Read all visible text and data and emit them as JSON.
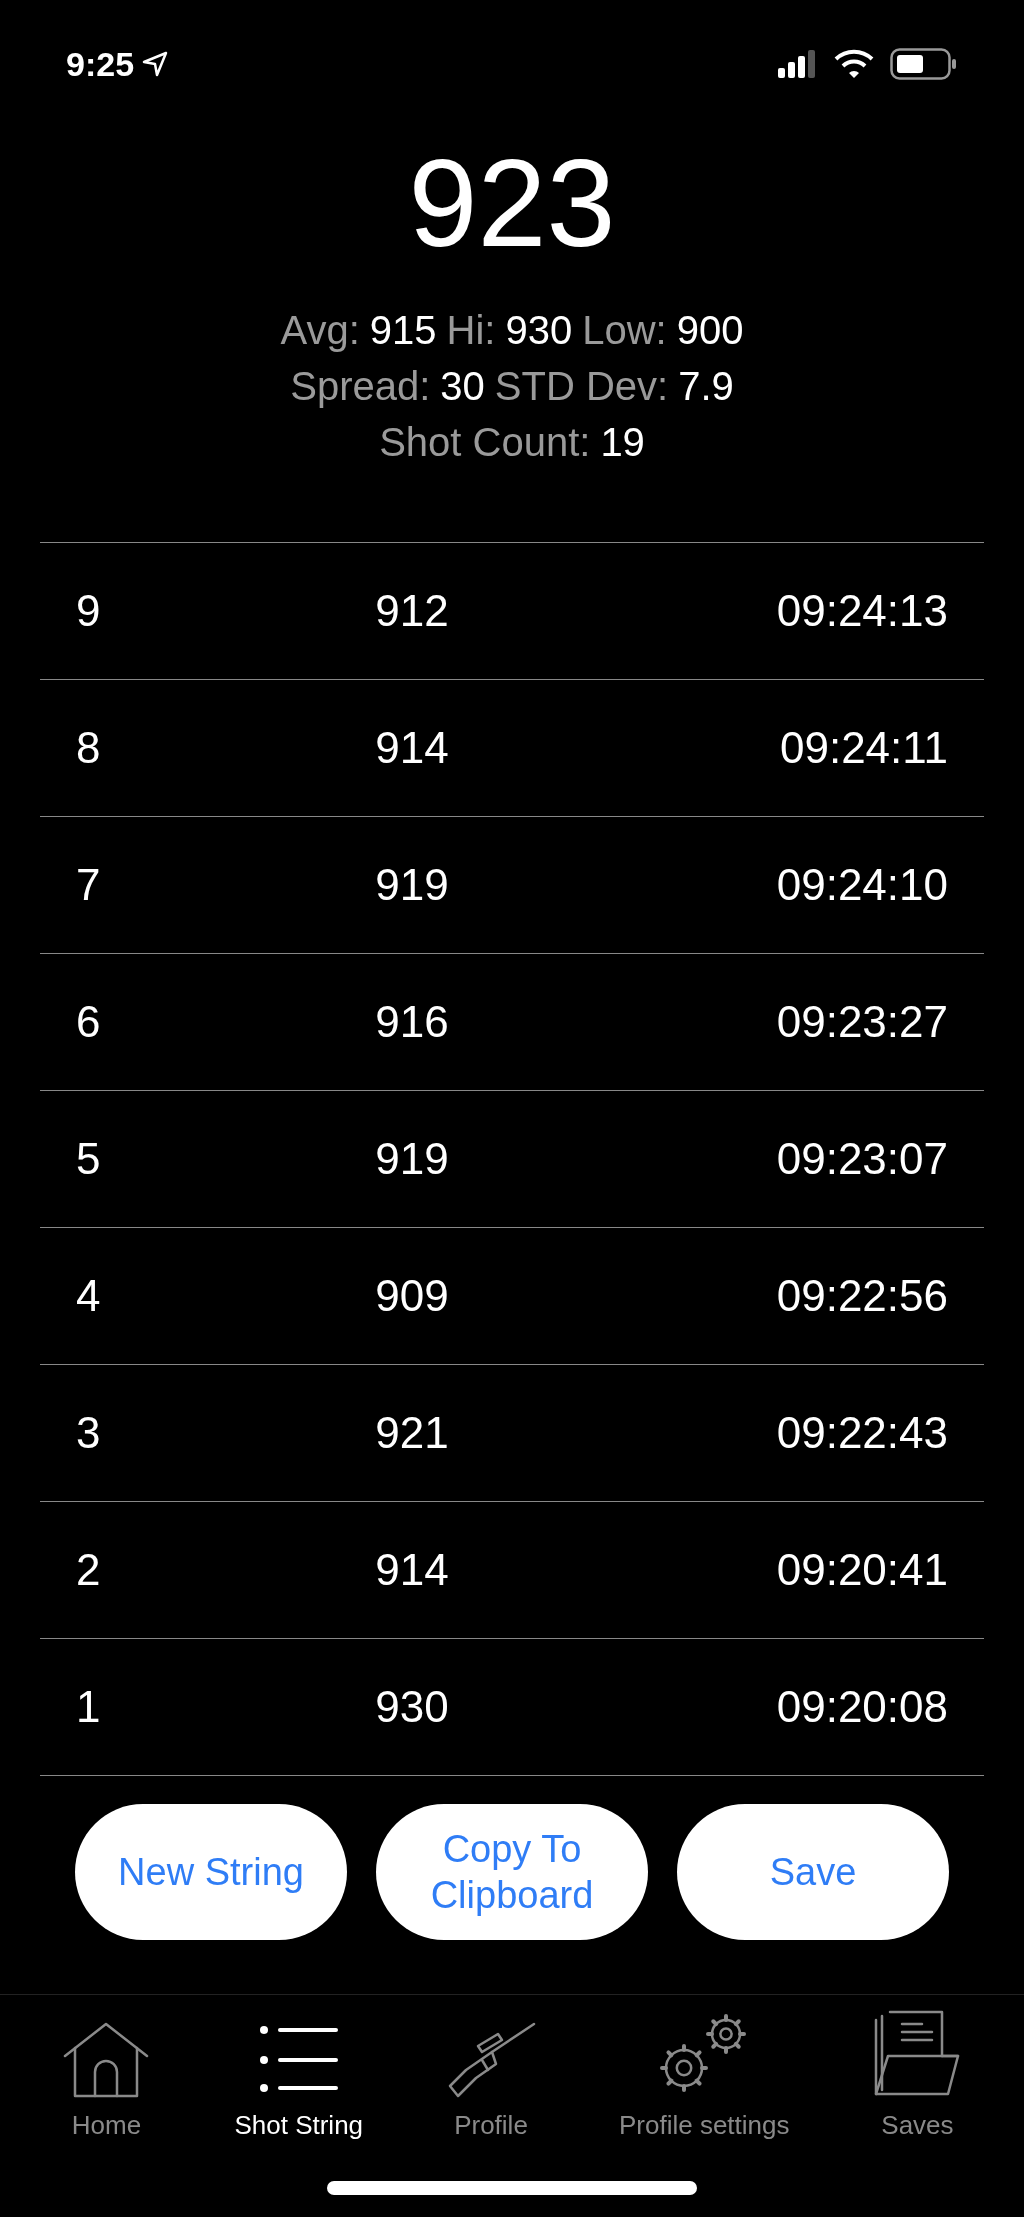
{
  "status_bar": {
    "time": "9:25"
  },
  "current_velocity": "923",
  "stats": [
    [
      {
        "label": "Avg:",
        "value": "915"
      },
      {
        "label": "Hi:",
        "value": "930"
      },
      {
        "label": "Low:",
        "value": "900"
      }
    ],
    [
      {
        "label": "Spread:",
        "value": "30"
      },
      {
        "label": "STD Dev:",
        "value": "7.9"
      }
    ],
    [
      {
        "label": "Shot Count:",
        "value": "19"
      }
    ]
  ],
  "shots": [
    {
      "number": "9",
      "velocity": "912",
      "time": "09:24:13"
    },
    {
      "number": "8",
      "velocity": "914",
      "time": "09:24:11"
    },
    {
      "number": "7",
      "velocity": "919",
      "time": "09:24:10"
    },
    {
      "number": "6",
      "velocity": "916",
      "time": "09:23:27"
    },
    {
      "number": "5",
      "velocity": "919",
      "time": "09:23:07"
    },
    {
      "number": "4",
      "velocity": "909",
      "time": "09:22:56"
    },
    {
      "number": "3",
      "velocity": "921",
      "time": "09:22:43"
    },
    {
      "number": "2",
      "velocity": "914",
      "time": "09:20:41"
    },
    {
      "number": "1",
      "velocity": "930",
      "time": "09:20:08"
    }
  ],
  "buttons": [
    {
      "label": "New String"
    },
    {
      "label": "Copy To Clipboard"
    },
    {
      "label": "Save"
    }
  ],
  "tabs": [
    {
      "kind": "home",
      "label": "Home",
      "selected": false
    },
    {
      "kind": "list",
      "label": "Shot String",
      "selected": true
    },
    {
      "kind": "rifle",
      "label": "Profile",
      "selected": false
    },
    {
      "kind": "gears",
      "label": "Profile settings",
      "selected": false
    },
    {
      "kind": "folder",
      "label": "Saves",
      "selected": false
    }
  ]
}
